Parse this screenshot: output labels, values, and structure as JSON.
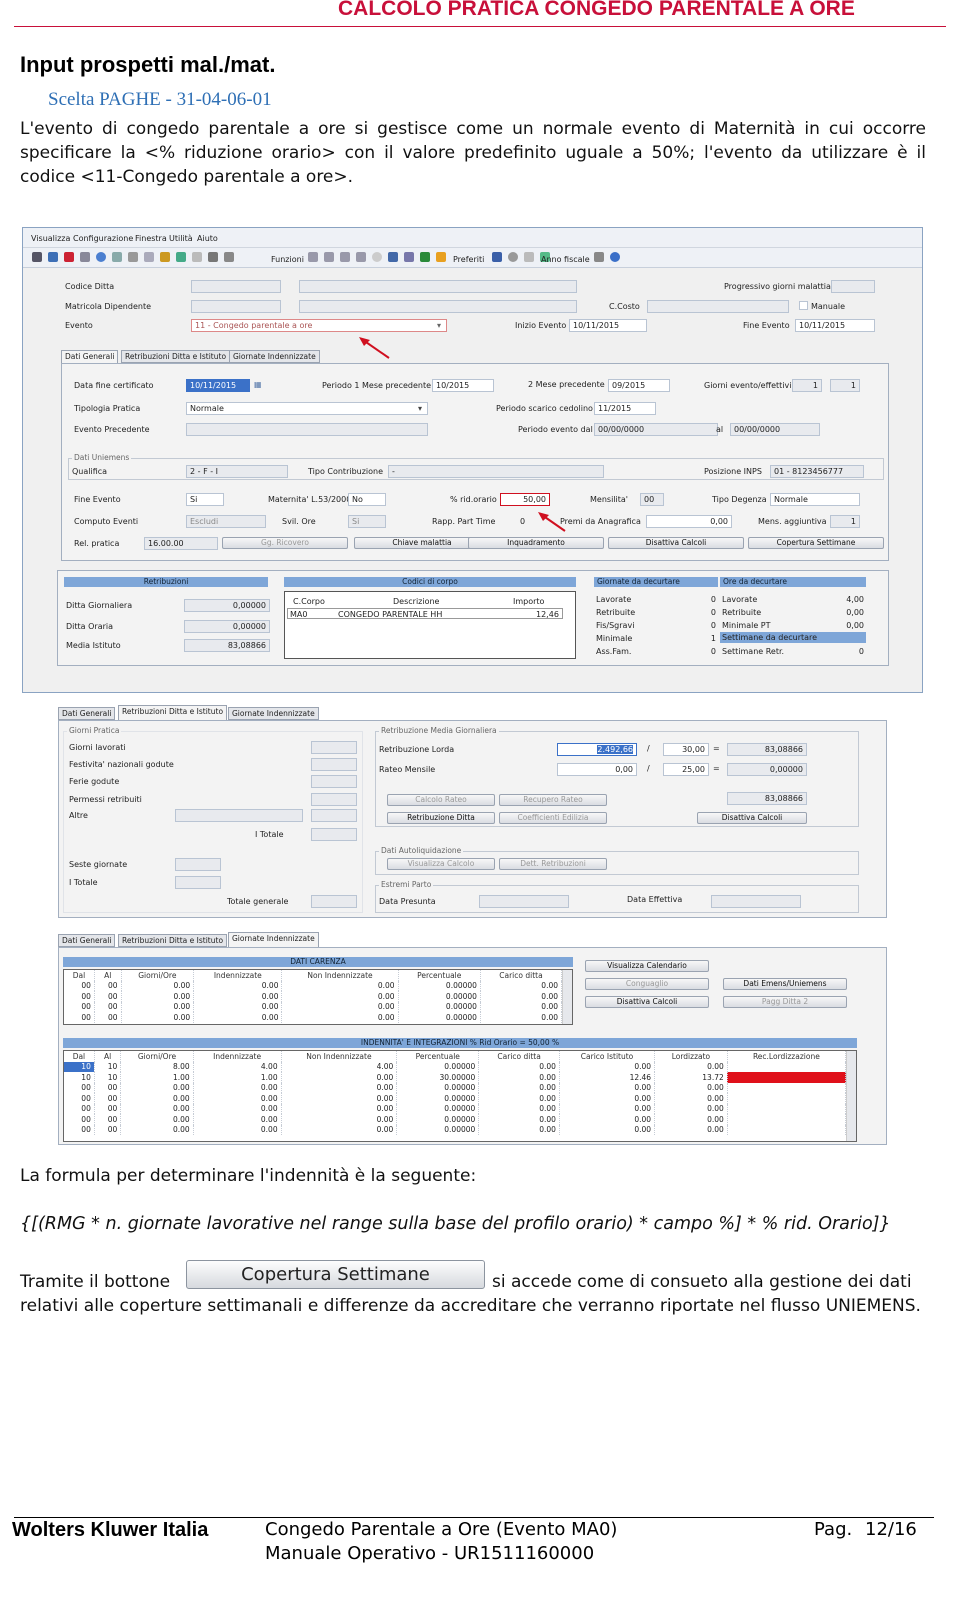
{
  "header": {
    "title": "CALCOLO PRATICA CONGEDO PARENTALE A ORE"
  },
  "section": {
    "heading": "Input prospetti mal./mat.",
    "subtitle": "Scelta PAGHE - 31-04-06-01"
  },
  "intro": "L'evento di congedo parentale a ore si gestisce come un normale evento di Maternità in cui occorre specificare la <% riduzione orario> con il valore predefinito uguale a 50%; l'evento da utilizzare è il codice <11-Congedo parentale a ore>.",
  "app": {
    "menu": [
      "Visualizza",
      "Configurazione",
      "Finestra",
      "Utilità",
      "Aiuto"
    ],
    "toolbar": {
      "funzioni": "Funzioni",
      "preferiti": "Preferiti",
      "anno": "Anno fiscale"
    },
    "top": {
      "codice_ditta": "Codice Ditta",
      "matricola": "Matricola Dipendente",
      "evento": "Evento",
      "evento_val": "11 - Congedo parentale a ore",
      "progressivo": "Progressivo giorni malattia",
      "ccosto": "C.Costo",
      "manuale": "Manuale",
      "inizio": "Inizio Evento",
      "inizio_val": "10/11/2015",
      "fine": "Fine Evento",
      "fine_val": "10/11/2015"
    },
    "tabs": [
      "Dati Generali",
      "Retribuzioni Ditta e Istituto",
      "Giornate Indennizzate"
    ],
    "gen": {
      "data_fine_cert": "Data fine certificato",
      "data_fine_val": "10/11/2015",
      "periodo1": "Periodo 1 Mese precedente",
      "periodo1_val": "10/2015",
      "mese2": "2 Mese precedente",
      "mese2_val": "09/2015",
      "giorni_ev": "Giorni evento/effettivi",
      "giorni_ev1": "1",
      "giorni_ev2": "1",
      "tipologia": "Tipologia Pratica",
      "tipologia_val": "Normale",
      "periodo_scarico": "Periodo scarico cedolino",
      "periodo_scarico_val": "11/2015",
      "evento_prec": "Evento Precedente",
      "periodo_evento": "Periodo evento dal",
      "periodo_evento_val": "00/00/0000",
      "al": "al",
      "al_val": "00/00/0000",
      "dati_uniemens": "Dati Uniemens",
      "qualifica": "Qualifica",
      "qualifica_val": "2 - F - I",
      "tipo_contr": "Tipo Contribuzione",
      "tipo_contr_val": "-",
      "posizione": "Posizione INPS",
      "posizione_val": "01 - 8123456777",
      "fine_evento": "Fine Evento",
      "fine_evento_val": "Si",
      "maternita": "Maternita' L.53/2000",
      "maternita_val": "No",
      "rid_orario": "% rid.orario",
      "rid_orario_val": "50,00",
      "mensilita": "Mensilita'",
      "mensilita_val": "00",
      "tipo_degenza": "Tipo Degenza",
      "tipo_degenza_val": "Normale",
      "computo": "Computo Eventi",
      "computo_val": "Escludi",
      "svil": "Svil. Ore",
      "svil_val": "Si",
      "rapp_part": "Rapp. Part Time",
      "rapp_part_val": "0",
      "premi": "Premi da Anagrafica",
      "premi_val": "0,00",
      "mens_agg": "Mens. aggiuntiva",
      "mens_agg_val": "1",
      "rel_pratica": "Rel. pratica",
      "rel_pratica_val": "16.00.00",
      "btn_gg": "Gg. Ricovero",
      "btn_chiave": "Chiave malattia",
      "btn_inq": "Inquadramento",
      "btn_dis": "Disattiva Calcoli",
      "btn_cop": "Copertura Settimane"
    },
    "retr": {
      "title": "Retribuzioni",
      "ditta_g": "Ditta Giornaliera",
      "ditta_g_val": "0,00000",
      "ditta_o": "Ditta Oraria",
      "ditta_o_val": "0,00000",
      "media": "Media Istituto",
      "media_val": "83,08866"
    },
    "codici": {
      "title": "Codici di corpo",
      "headers": [
        "C.Corpo",
        "Descrizione",
        "Importo"
      ],
      "row": [
        "MA0",
        "CONGEDO PARENTALE HH",
        "12,46"
      ]
    },
    "gdec": {
      "title": "Giornate da decurtare",
      "rows": [
        [
          "Lavorate",
          "0"
        ],
        [
          "Retribuite",
          "0"
        ],
        [
          "Fis/Sgravi",
          "0"
        ],
        [
          "Minimale",
          "1"
        ],
        [
          "Ass.Fam.",
          "0"
        ]
      ]
    },
    "odec": {
      "title": "Ore da decurtare",
      "rows": [
        [
          "Lavorate",
          "4,00"
        ],
        [
          "Retribuite",
          "0,00"
        ],
        [
          "Minimale PT",
          "0,00"
        ],
        [
          "Settimane da decurtare",
          ""
        ],
        [
          "Settimane Retr.",
          "0"
        ]
      ]
    }
  },
  "app2": {
    "tabs": [
      "Dati Generali",
      "Retribuzioni Ditta e Istituto",
      "Giornate Indennizzate"
    ],
    "giorni_pratica": "Giorni Pratica",
    "left": [
      "Giorni lavorati",
      "Festivita' nazionali godute",
      "Ferie godute",
      "Permessi retribuiti",
      "Altre"
    ],
    "i_totale": "I Totale",
    "seste": "Seste giornate",
    "i_totale2": "I Totale",
    "totale_gen": "Totale generale",
    "rmg": "Retribuzione Media Giornaliera",
    "rl": "Retribuzione Lorda",
    "rl_val": "2.492,66",
    "rl_div": "30,00",
    "rl_res": "83,08866",
    "rm": "Rateo Mensile",
    "rm_val": "0,00",
    "rm_div": "25,00",
    "rm_res": "0,00000",
    "tot": "83,08866",
    "b_calc": "Calcolo Rateo",
    "b_rec": "Recupero Rateo",
    "b_rd": "Retribuzione Ditta",
    "b_coef": "Coefficienti Edilizia",
    "b_dis": "Disattiva Calcoli",
    "autoliq": "Dati Autoliquidazione",
    "b_vis": "Visualizza Calcolo",
    "b_dett": "Dett. Retribuzioni",
    "estremi": "Estremi Parto",
    "presunta": "Data Presunta",
    "effettiva": "Data Effettiva"
  },
  "app3": {
    "tabs": [
      "Dati Generali",
      "Retribuzioni Ditta e Istituto",
      "Giornate Indennizzate"
    ],
    "carenza_title": "DATI CARENZA",
    "carenza_headers": [
      "Dal",
      "Al",
      "Giorni/Ore",
      "Indennizzate",
      "Non Indennizzate",
      "Percentuale",
      "Carico ditta"
    ],
    "carenza_rows": [
      [
        "00",
        "00",
        "0.00",
        "0.00",
        "0.00",
        "0.00000",
        "0.00"
      ],
      [
        "00",
        "00",
        "0.00",
        "0.00",
        "0.00",
        "0.00000",
        "0.00"
      ],
      [
        "00",
        "00",
        "0.00",
        "0.00",
        "0.00",
        "0.00000",
        "0.00"
      ],
      [
        "00",
        "00",
        "0.00",
        "0.00",
        "0.00",
        "0.00000",
        "0.00"
      ]
    ],
    "b_cal": "Visualizza Calendario",
    "b_cong": "Conguaglio",
    "b_emens": "Dati Emens/Uniemens",
    "b_dis": "Disattiva Calcoli",
    "b_pag": "Pagg Ditta 2",
    "ind_title": "INDENNITA' E INTEGRAZIONI % Rid Orario = 50,00 %",
    "ind_headers": [
      "Dal",
      "Al",
      "Giorni/Ore",
      "Indennizzate",
      "Non Indennizzate",
      "Percentuale",
      "Carico ditta",
      "Carico Istituto",
      "Lordizzato",
      "Rec.Lordizzazione"
    ],
    "ind_rows": [
      [
        "10",
        "10",
        "8.00",
        "4.00",
        "4.00",
        "0.00000",
        "0.00",
        "0.00",
        "0.00",
        ""
      ],
      [
        "10",
        "10",
        "1.00",
        "1.00",
        "0.00",
        "30.00000",
        "0.00",
        "12.46",
        "13.72",
        ""
      ],
      [
        "00",
        "00",
        "0.00",
        "0.00",
        "0.00",
        "0.00000",
        "0.00",
        "0.00",
        "0.00",
        ""
      ],
      [
        "00",
        "00",
        "0.00",
        "0.00",
        "0.00",
        "0.00000",
        "0.00",
        "0.00",
        "0.00",
        ""
      ],
      [
        "00",
        "00",
        "0.00",
        "0.00",
        "0.00",
        "0.00000",
        "0.00",
        "0.00",
        "0.00",
        ""
      ],
      [
        "00",
        "00",
        "0.00",
        "0.00",
        "0.00",
        "0.00000",
        "0.00",
        "0.00",
        "0.00",
        ""
      ],
      [
        "00",
        "00",
        "0.00",
        "0.00",
        "0.00",
        "0.00000",
        "0.00",
        "0.00",
        "0.00",
        ""
      ]
    ]
  },
  "formula_intro": "La formula per determinare l'indennità è la seguente:",
  "formula": "{[(RMG * n. giornate lavorative nel range sulla base del profilo orario) * campo %] * % rid. Orario]}",
  "tramite": "Tramite il bottone",
  "btn_label": "Copertura Settimane",
  "tramite_rest": "si accede come di consueto alla gestione dei dati",
  "tramite_para": "relativi alle coperture settimanali e differenze da accreditare che verranno riportate nel flusso UNIEMENS.",
  "footer": {
    "company": "Wolters Kluwer Italia",
    "doc": "Congedo Parentale a Ore (Evento MA0)",
    "manual": "Manuale Operativo - UR1511160000",
    "pag": "Pag.",
    "page": "12/16"
  },
  "colors": {
    "accent": "#c8103a",
    "link": "#2e6fb5",
    "grid_header": "#7ea6d8",
    "highlight": "#e0101a"
  }
}
